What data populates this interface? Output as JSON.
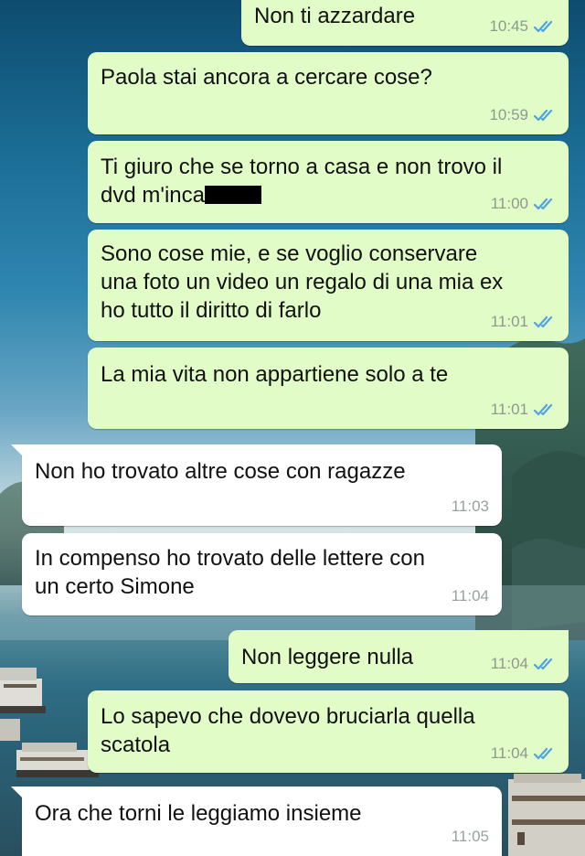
{
  "colors": {
    "outgoing_bubble": "#e2fcc8",
    "incoming_bubble": "#ffffff",
    "read_ticks": "#4fa3e0",
    "timestamp": "#8d9a8b"
  },
  "icons": {
    "read_receipt": "double-check-icon"
  },
  "messages": [
    {
      "direction": "out",
      "text": "Non ti azzardare",
      "time": "10:45",
      "status": "read"
    },
    {
      "direction": "out",
      "text": "Paola stai ancora a cercare cose?",
      "time": "10:59",
      "status": "read"
    },
    {
      "direction": "out",
      "text_before_redaction": "Ti giuro che se torno a casa e non trovo il\ndvd m'inca",
      "time": "11:00",
      "status": "read"
    },
    {
      "direction": "out",
      "text": "Sono cose mie, e se voglio conservare\nuna foto un video un regalo di una mia ex\nho tutto il diritto di farlo",
      "time": "11:01",
      "status": "read"
    },
    {
      "direction": "out",
      "text": "La mia vita non appartiene solo a te",
      "time": "11:01",
      "status": "read"
    },
    {
      "direction": "in",
      "text": "Non ho trovato altre cose con ragazze",
      "time": "11:03"
    },
    {
      "direction": "in",
      "text": "In compenso ho trovato delle lettere con\nun certo Simone",
      "time": "11:04"
    },
    {
      "direction": "out",
      "text": "Non leggere nulla",
      "time": "11:04",
      "status": "read"
    },
    {
      "direction": "out",
      "text": "Lo sapevo che dovevo bruciarla quella\nscatola",
      "time": "11:04",
      "status": "read"
    },
    {
      "direction": "in",
      "text": "Ora che torni le leggiamo insieme",
      "time": "11:05"
    }
  ]
}
